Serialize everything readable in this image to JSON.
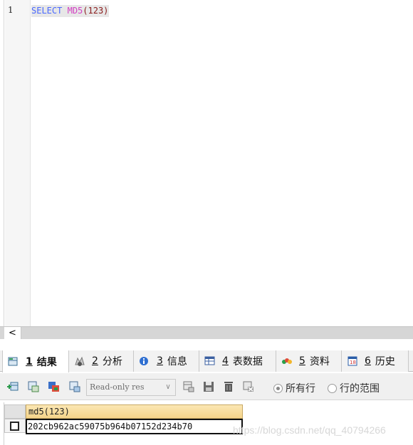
{
  "editor": {
    "line_number": "1",
    "code": {
      "keyword": "SELECT",
      "function": "MD5",
      "args": "(123)"
    }
  },
  "scrollbar": {
    "left_arrow": "<"
  },
  "tabs": [
    {
      "num": "1",
      "label": "结果",
      "icon": "result-grid-icon",
      "active": true
    },
    {
      "num": "2",
      "label": "分析",
      "icon": "profile-icon"
    },
    {
      "num": "3",
      "label": "信息",
      "icon": "info-icon"
    },
    {
      "num": "4",
      "label": "表数据",
      "icon": "table-data-icon"
    },
    {
      "num": "5",
      "label": "资料",
      "icon": "chart-icon"
    },
    {
      "num": "6",
      "label": "历史",
      "icon": "calendar-icon"
    }
  ],
  "toolbar": {
    "buttons": [
      "add-row-icon",
      "copy-row-icon",
      "export-icon",
      "import-icon",
      "refresh-icon",
      "save-icon",
      "delete-icon",
      "cancel-icon"
    ],
    "readonly_select": "Read-only res",
    "radio_all_rows": "所有行",
    "radio_row_range": "行的范围"
  },
  "grid": {
    "column_header": "md5(123)",
    "rows": [
      {
        "value": "202cb962ac59075b964b07152d234b70"
      }
    ]
  },
  "watermark": "https://blog.csdn.net/qq_40794266",
  "colors": {
    "keyword": "#4a69ff",
    "function": "#d341c3",
    "args": "#8a1b1b",
    "header_bg": "#f5d48a"
  }
}
